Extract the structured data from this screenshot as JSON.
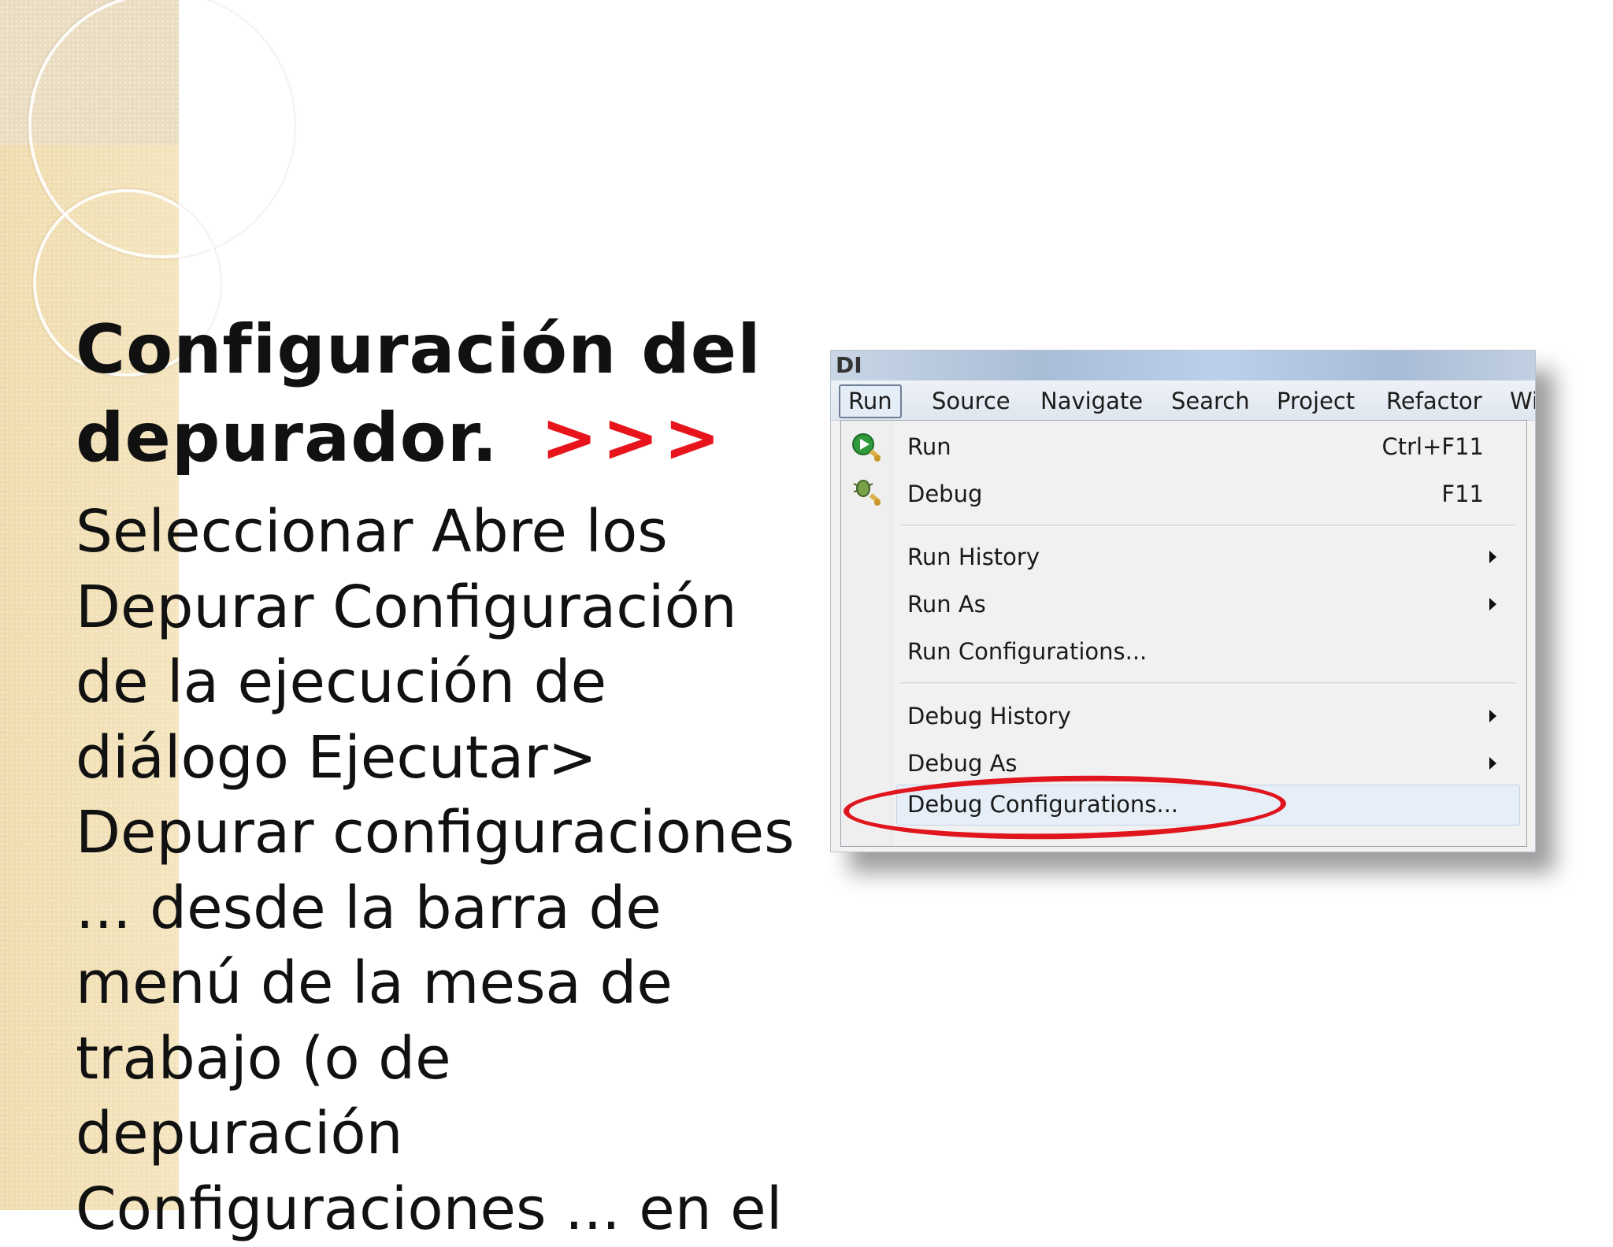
{
  "slide": {
    "title_line1": "Configuración del",
    "title_line2": "depurador.",
    "title_arrows": ">>>",
    "body_lines": [
      "Seleccionar Abre los",
      "Depurar Configuración",
      "de la ejecución de",
      "diálogo Ejecutar>",
      "Depurar configuraciones",
      "... desde la barra de",
      "menú de la mesa de",
      "trabajo (o de",
      "depuración",
      "Configuraciones ... en el"
    ]
  },
  "screenshot": {
    "titlebar_text": "DI",
    "menubar": {
      "items": [
        "Run",
        "Source",
        "Navigate",
        "Search",
        "Project",
        "Refactor",
        "Wir"
      ],
      "active": "Run"
    },
    "run_menu": {
      "run": {
        "label": "Run",
        "shortcut": "Ctrl+F11",
        "icon": "run-icon"
      },
      "debug": {
        "label": "Debug",
        "shortcut": "F11",
        "icon": "debug-icon"
      },
      "run_history": "Run History",
      "run_as": "Run As",
      "run_configurations": "Run Configurations...",
      "debug_history": "Debug History",
      "debug_as": "Debug As",
      "debug_configurations": "Debug Configurations..."
    },
    "highlight_color": "#e0151d"
  },
  "colors": {
    "arrows": "#e8141c",
    "side_band": "#f1dfb2"
  }
}
